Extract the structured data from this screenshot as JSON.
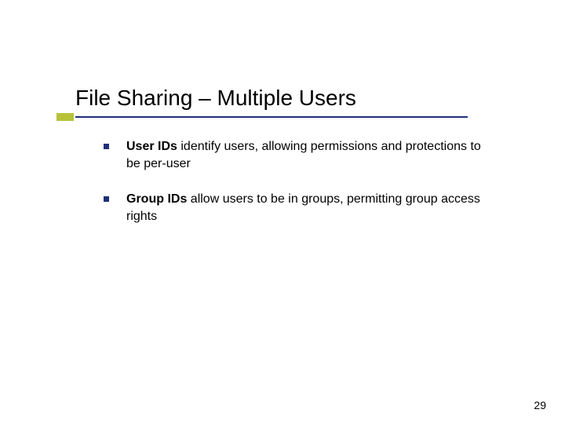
{
  "slide": {
    "title": "File Sharing – Multiple Users",
    "bullets": [
      {
        "bold": "User IDs",
        "rest": " identify users, allowing permissions and protections to be per-user"
      },
      {
        "bold": "Group IDs",
        "rest": " allow users to be in groups, permitting group access rights"
      }
    ],
    "page_number": "29"
  },
  "colors": {
    "underline": "#1f2f78",
    "accent": "#b7c23a",
    "bullet_marker": "#1f2f78"
  }
}
